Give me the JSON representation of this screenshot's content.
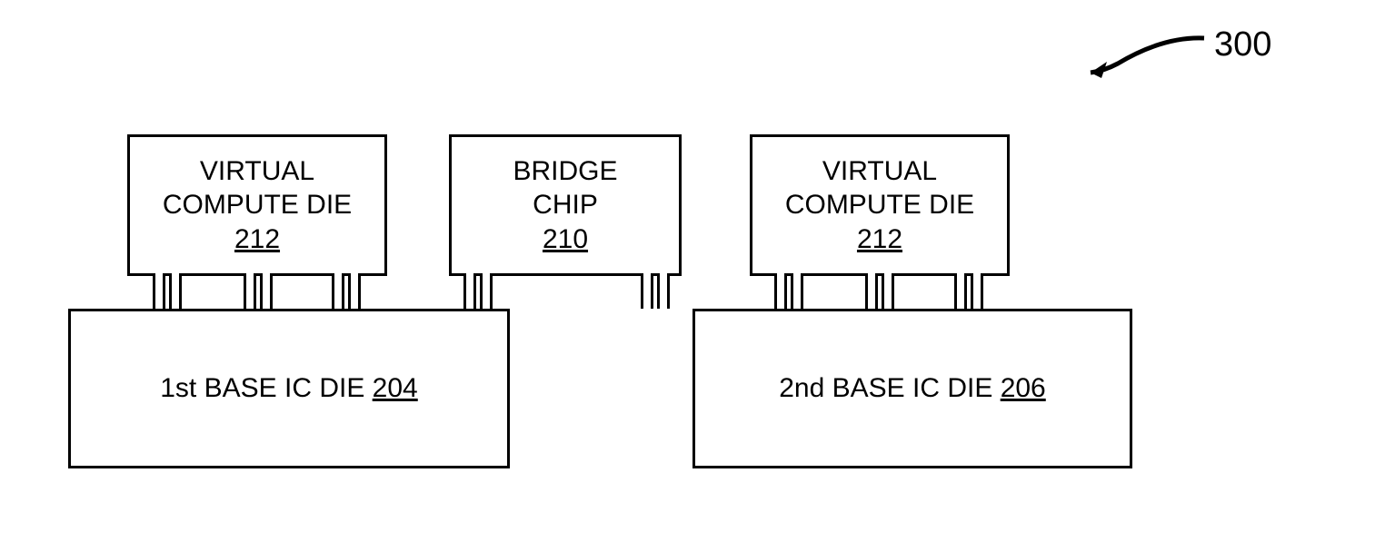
{
  "figure_ref": "300",
  "blocks": {
    "vcd_left": {
      "line1": "VIRTUAL",
      "line2": "COMPUTE DIE",
      "ref": "212"
    },
    "bridge": {
      "line1": "BRIDGE",
      "line2": "CHIP",
      "ref": "210"
    },
    "vcd_right": {
      "line1": "VIRTUAL",
      "line2": "COMPUTE DIE",
      "ref": "212"
    },
    "base_left": {
      "label": "1st BASE IC DIE ",
      "ref": "204"
    },
    "base_right": {
      "label": "2nd BASE IC DIE ",
      "ref": "206"
    }
  }
}
